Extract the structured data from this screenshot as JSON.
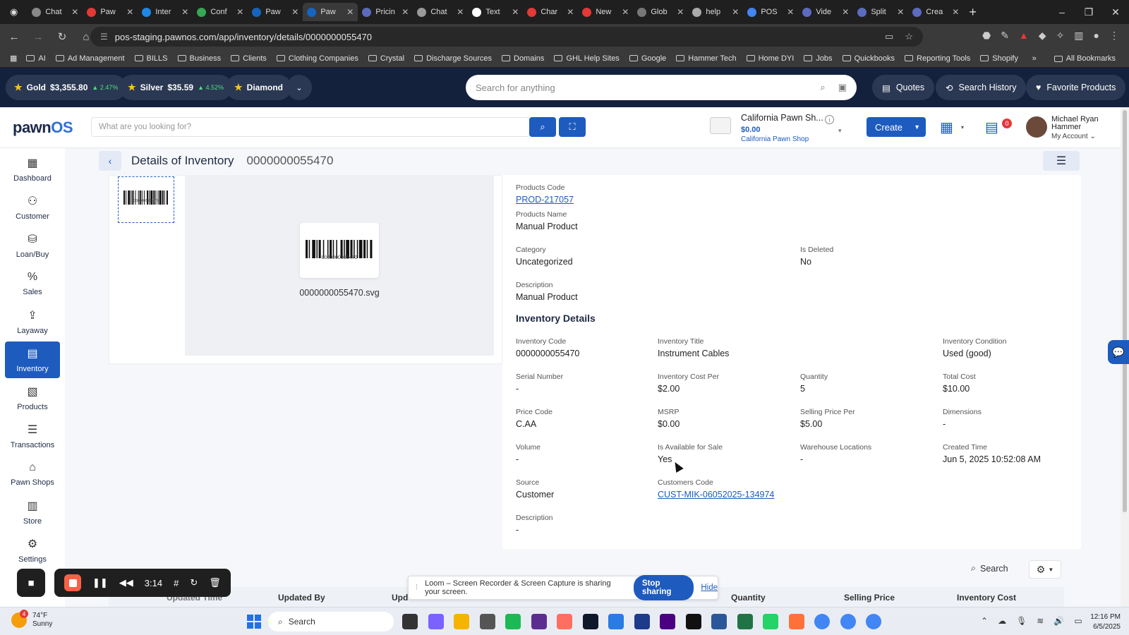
{
  "browser": {
    "tabs": [
      "Chat",
      "Paw",
      "Inter",
      "Conf",
      "Paw",
      "Paw",
      "Pricin",
      "Chat",
      "Text",
      "Char",
      "New",
      "Glob",
      "help",
      "POS",
      "Vide",
      "Split",
      "Crea"
    ],
    "active_tab_index": 5,
    "new_tab": "+",
    "url": "pos-staging.pawnos.com/app/inventory/details/0000000055470",
    "bookmarks": [
      "AI",
      "Ad Management",
      "BILLS",
      "Business",
      "Clients",
      "Clothing Companies",
      "Crystal",
      "Discharge Sources",
      "Domains",
      "GHL Help Sites",
      "Google",
      "Hammer Tech",
      "Home DYI",
      "Jobs",
      "Quickbooks",
      "Reporting Tools",
      "Shopify"
    ],
    "bookmarks_more": "»",
    "all_bookmarks": "All Bookmarks"
  },
  "metals": {
    "gold": {
      "label": "Gold",
      "price": "$3,355.80",
      "change": "2.47%"
    },
    "silver": {
      "label": "Silver",
      "price": "$35.59",
      "change": "4.52%"
    },
    "diamond": {
      "label": "Diamond"
    }
  },
  "global_search": {
    "placeholder": "Search for anything"
  },
  "toolbar": {
    "quotes": "Quotes",
    "search_history": "Search History",
    "favorite_products": "Favorite Products"
  },
  "header": {
    "logo_main": "pawn",
    "logo_accent": "OS",
    "search_placeholder": "What are you looking for?",
    "shop_name": "California Pawn Sh...",
    "shop_balance": "$0.00",
    "shop_sub": "California Pawn Shop",
    "create": "Create",
    "notifications": "0",
    "user_name": "Michael Ryan Hammer",
    "my_account": "My Account"
  },
  "nav": [
    {
      "label": "Dashboard",
      "icon": "dashboard-icon"
    },
    {
      "label": "Customer",
      "icon": "customer-icon"
    },
    {
      "label": "Loan/Buy",
      "icon": "loan-icon"
    },
    {
      "label": "Sales",
      "icon": "sales-icon"
    },
    {
      "label": "Layaway",
      "icon": "layaway-icon"
    },
    {
      "label": "Inventory",
      "icon": "inventory-icon",
      "active": true
    },
    {
      "label": "Products",
      "icon": "products-icon"
    },
    {
      "label": "Transactions",
      "icon": "transactions-icon"
    },
    {
      "label": "Pawn Shops",
      "icon": "pawnshops-icon"
    },
    {
      "label": "Store",
      "icon": "store-icon"
    },
    {
      "label": "Settings",
      "icon": "settings-icon"
    }
  ],
  "page": {
    "title": "Details of Inventory",
    "code": "0000000055470",
    "thumb_caption": "0000000055470",
    "barcode_caption": "0000000055470",
    "filename": "0000000055470.svg"
  },
  "product": {
    "products_code": {
      "label": "Products Code",
      "value": "PROD-217057"
    },
    "products_name": {
      "label": "Products Name",
      "value": "Manual Product"
    },
    "category": {
      "label": "Category",
      "value": "Uncategorized"
    },
    "is_deleted": {
      "label": "Is Deleted",
      "value": "No"
    },
    "description": {
      "label": "Description",
      "value": "Manual Product"
    }
  },
  "inventory": {
    "section_title": "Inventory Details",
    "inventory_code": {
      "label": "Inventory Code",
      "value": "0000000055470"
    },
    "inventory_title": {
      "label": "Inventory Title",
      "value": "Instrument Cables"
    },
    "inventory_condition": {
      "label": "Inventory Condition",
      "value": "Used (good)"
    },
    "serial_number": {
      "label": "Serial Number",
      "value": "-"
    },
    "cost_per": {
      "label": "Inventory Cost Per",
      "value": "$2.00"
    },
    "quantity": {
      "label": "Quantity",
      "value": "5"
    },
    "total_cost": {
      "label": "Total Cost",
      "value": "$10.00"
    },
    "price_code": {
      "label": "Price Code",
      "value": "C.AA"
    },
    "msrp": {
      "label": "MSRP",
      "value": "$0.00"
    },
    "selling_price_per": {
      "label": "Selling Price Per",
      "value": "$5.00"
    },
    "dimensions": {
      "label": "Dimensions",
      "value": "-"
    },
    "volume": {
      "label": "Volume",
      "value": "-"
    },
    "available_for_sale": {
      "label": "Is Available for Sale",
      "value": "Yes"
    },
    "warehouse_locations": {
      "label": "Warehouse Locations",
      "value": "-"
    },
    "created_time": {
      "label": "Created Time",
      "value": "Jun 5, 2025 10:52:08 AM"
    },
    "source": {
      "label": "Source",
      "value": "Customer"
    },
    "customers_code": {
      "label": "Customers Code",
      "value": "CUST-MIK-06052025-134974"
    },
    "description": {
      "label": "Description",
      "value": "-"
    }
  },
  "table": {
    "search": "Search",
    "columns": [
      "Updated Time",
      "Updated By",
      "Upd",
      "Quantity",
      "Selling Price",
      "Inventory Cost"
    ]
  },
  "loom": {
    "timer": "3:14",
    "message": "Loom – Screen Recorder & Screen Capture is sharing your screen.",
    "stop_sharing": "Stop sharing",
    "hide": "Hide"
  },
  "taskbar": {
    "temp": "74°F",
    "condition": "Sunny",
    "weather_badge": "4",
    "search": "Search",
    "time": "12:16 PM",
    "date": "6/5/2025"
  }
}
